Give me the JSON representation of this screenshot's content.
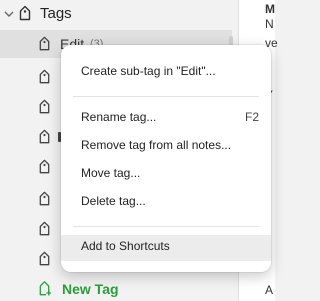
{
  "sidebar": {
    "header_label": "Tags",
    "selected_tag": {
      "label": "Edit",
      "count": "(3)"
    },
    "new_tag_label": "New Tag",
    "colors": {
      "new_tag": "#2a9d3c",
      "selected_row": "#e0e0e0"
    }
  },
  "right_pane": {
    "snippets": [
      "M",
      "N",
      "ve",
      "Y",
      "A"
    ]
  },
  "context_menu": {
    "create_subtag": "Create sub-tag in \"Edit\"...",
    "rename": "Rename tag...",
    "rename_shortcut": "F2",
    "remove": "Remove tag from all notes...",
    "move": "Move tag...",
    "delete": "Delete tag...",
    "add_shortcuts": "Add to Shortcuts"
  }
}
